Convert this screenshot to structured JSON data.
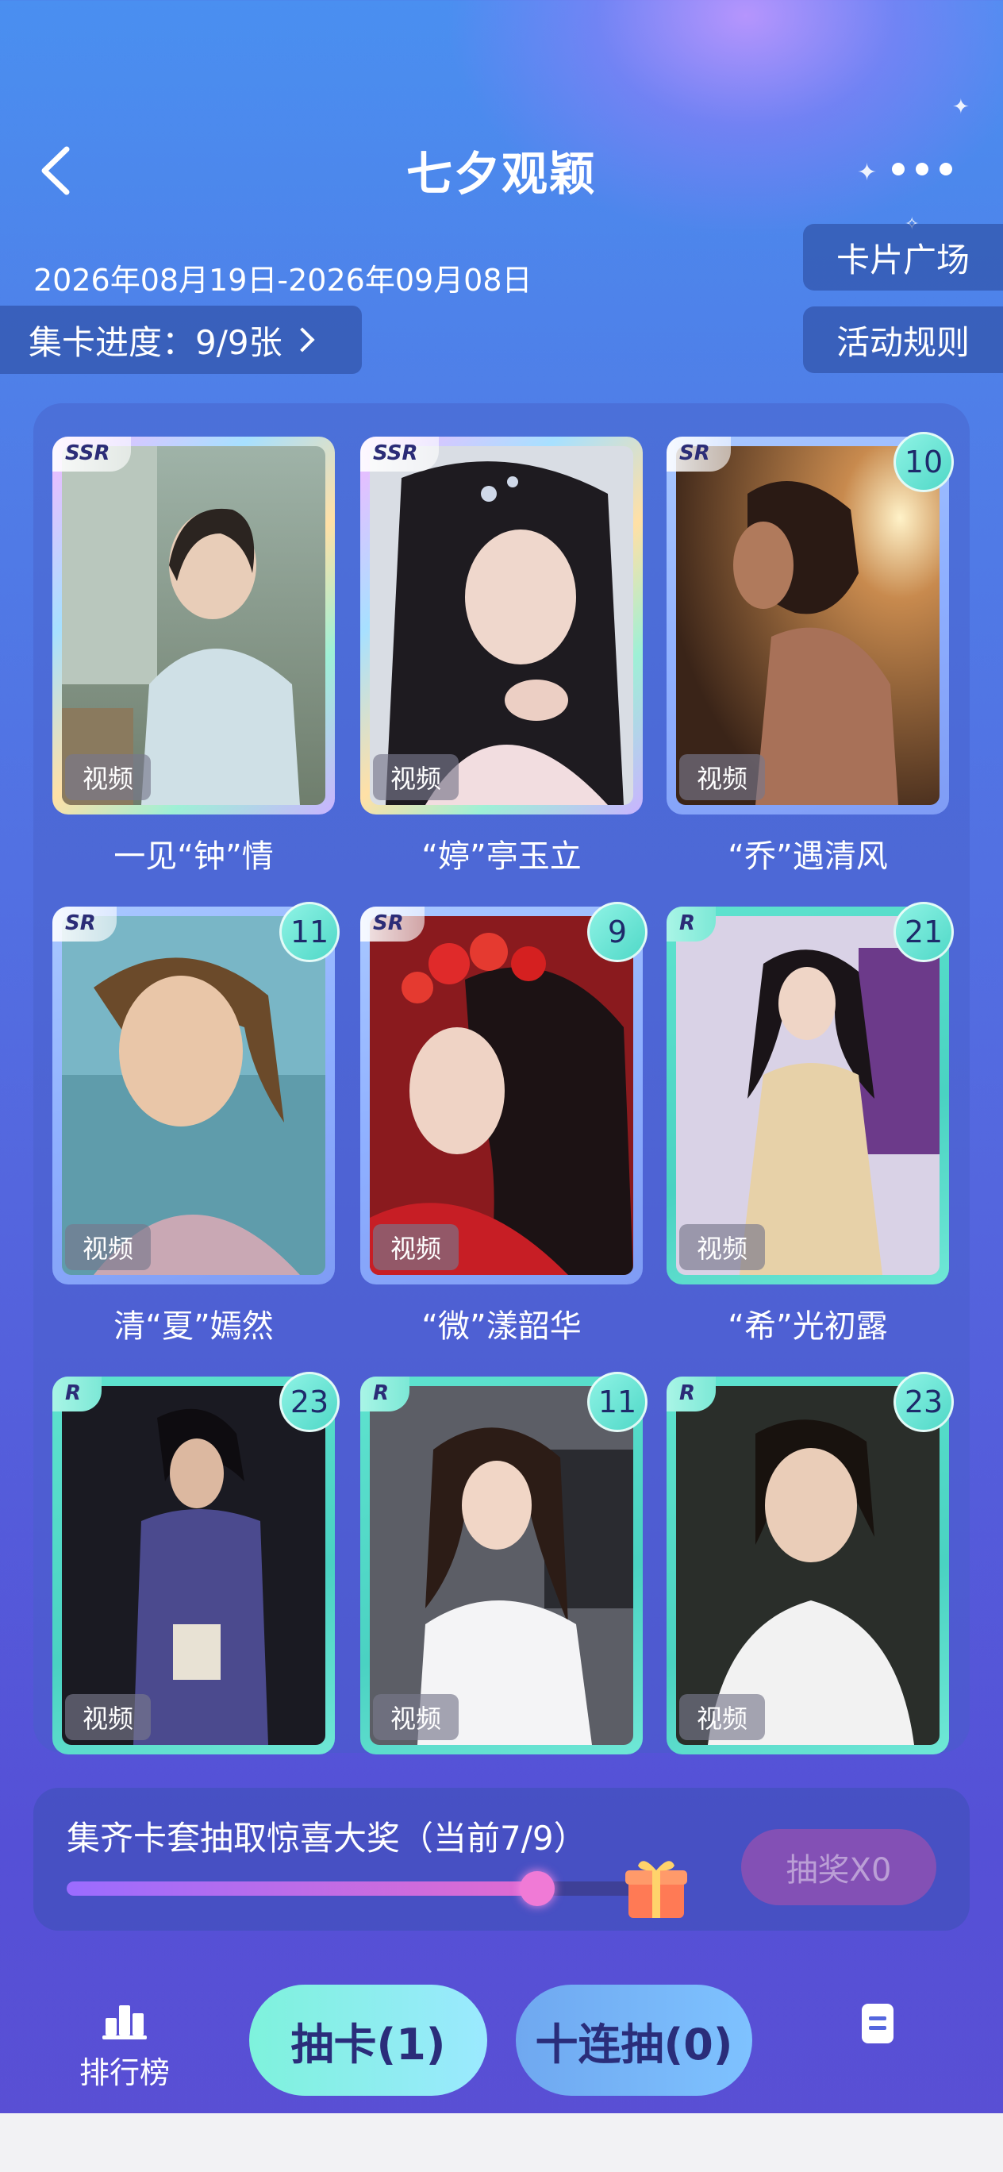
{
  "header": {
    "title": "七夕观颖",
    "date_range": "2026年08月19日-2026年09月08日",
    "progress_label": "集卡进度：9/9张",
    "card_plaza": "卡片广场",
    "activity_rules": "活动规则"
  },
  "cards": [
    {
      "name": "一见“钟”情",
      "rarity": "SSR",
      "count": "",
      "tag": "视频"
    },
    {
      "name": "“婷”亭玉立",
      "rarity": "SSR",
      "count": "",
      "tag": "视频"
    },
    {
      "name": "“乔”遇清风",
      "rarity": "SR",
      "count": "10",
      "tag": "视频"
    },
    {
      "name": "清“夏”嫣然",
      "rarity": "SR",
      "count": "11",
      "tag": "视频"
    },
    {
      "name": "“微”漾韶华",
      "rarity": "SR",
      "count": "9",
      "tag": "视频"
    },
    {
      "name": "“希”光初露",
      "rarity": "R",
      "count": "21",
      "tag": "视频"
    },
    {
      "name": "",
      "rarity": "R",
      "count": "23",
      "tag": "视频"
    },
    {
      "name": "",
      "rarity": "R",
      "count": "11",
      "tag": "视频"
    },
    {
      "name": "",
      "rarity": "R",
      "count": "23",
      "tag": "视频"
    }
  ],
  "lottery": {
    "text": "集齐卡套抽取惊喜大奖（当前7/9）",
    "progress": 0.78,
    "button": "抽奖X0"
  },
  "bottom": {
    "rank_label": "排行榜",
    "draw_one": "抽卡(1)",
    "draw_ten": "十连抽(0)"
  },
  "colors": {
    "bg_top": "#4a8ff0",
    "bg_bottom": "#5a4fd4",
    "accent_teal": "#7ef2dc",
    "accent_pink": "#e06bd0"
  }
}
